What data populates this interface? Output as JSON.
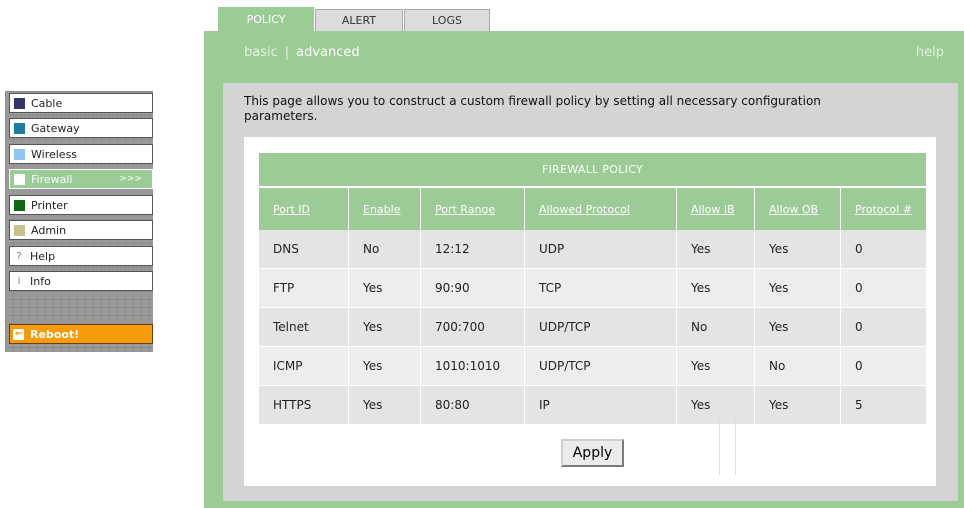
{
  "tabs": [
    {
      "label": "POLICY",
      "active": true
    },
    {
      "label": "ALERT",
      "active": false
    },
    {
      "label": "LOGS",
      "active": false
    }
  ],
  "subnav": {
    "basic": "basic",
    "advanced": "advanced",
    "help": "help"
  },
  "description": "This page allows you to construct a custom firewall policy by setting all necessary configuration parameters.",
  "sidebar": {
    "items": [
      {
        "label": "Cable",
        "icon": "square-icon",
        "color": "#34346a"
      },
      {
        "label": "Gateway",
        "icon": "square-icon",
        "color": "#1f7aa8"
      },
      {
        "label": "Wireless",
        "icon": "square-icon",
        "color": "#8fc6f0"
      },
      {
        "label": "Firewall",
        "icon": "square-icon",
        "color": "#9ccc96",
        "arrow": ">>>"
      },
      {
        "label": "Printer",
        "icon": "square-icon",
        "color": "#0d6a12"
      },
      {
        "label": "Admin",
        "icon": "square-icon",
        "color": "#c9c08e"
      },
      {
        "label": "Help",
        "icon": "question-icon",
        "glyph": "?"
      },
      {
        "label": "Info",
        "icon": "info-icon",
        "glyph": "i"
      }
    ],
    "reboot_label": "Reboot!"
  },
  "table": {
    "title": "FIREWALL POLICY",
    "columns": [
      "Port ID",
      "Enable",
      "Port Range",
      "Allowed Protocol",
      "Allow IB",
      "Allow OB",
      "Protocol #"
    ],
    "rows": [
      [
        "DNS",
        "No",
        "12:12",
        "UDP",
        "Yes",
        "Yes",
        "0"
      ],
      [
        "FTP",
        "Yes",
        "90:90",
        "TCP",
        "Yes",
        "Yes",
        "0"
      ],
      [
        "Telnet",
        "Yes",
        "700:700",
        "UDP/TCP",
        "No",
        "Yes",
        "0"
      ],
      [
        "ICMP",
        "Yes",
        "1010:1010",
        "UDP/TCP",
        "Yes",
        "No",
        "0"
      ],
      [
        "HTTPS",
        "Yes",
        "80:80",
        "IP",
        "Yes",
        "Yes",
        "5"
      ]
    ]
  },
  "apply_label": "Apply",
  "colors": {
    "accent": "#9ccc96",
    "reboot": "#f79a0c"
  }
}
